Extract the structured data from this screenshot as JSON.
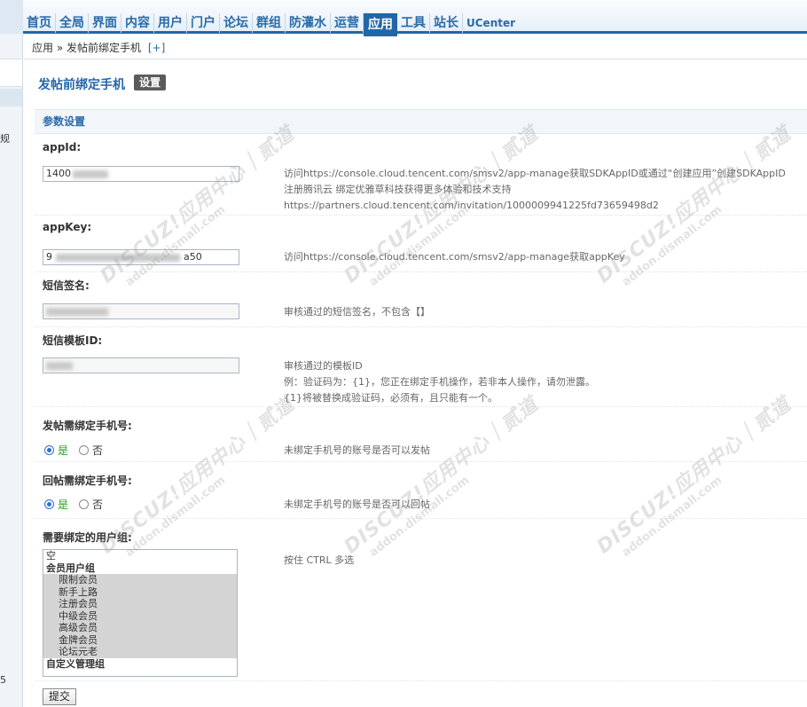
{
  "nav": {
    "items": [
      "首页",
      "全局",
      "界面",
      "内容",
      "用户",
      "门户",
      "论坛",
      "群组",
      "防灌水",
      "运营",
      "应用",
      "工具",
      "站长",
      "UCenter"
    ],
    "active_index": 10
  },
  "sidebar": {
    "chars": [
      "规",
      "5"
    ]
  },
  "breadcrumb": {
    "root": "应用",
    "sep": "»",
    "current": "发帖前绑定手机",
    "add": "[+]"
  },
  "page": {
    "title": "发帖前绑定手机",
    "tab_label": "设置"
  },
  "section": {
    "title": "参数设置"
  },
  "fields": {
    "appid": {
      "label": "appId:",
      "value": "1400",
      "desc": [
        "访问https://console.cloud.tencent.com/smsv2/app-manage获取SDKAppID或通过“创建应用”创建SDKAppID",
        "注册腾讯云 绑定优雅草科技获得更多体验和技术支持",
        "https://partners.cloud.tencent.com/invitation/1000009941225fd73659498d2"
      ]
    },
    "appkey": {
      "label": "appKey:",
      "value_start": "9",
      "value_end": "a50",
      "desc": "访问https://console.cloud.tencent.com/smsv2/app-manage获取appKey"
    },
    "sign": {
      "label": "短信签名:",
      "desc": "审核通过的短信签名，不包含【】"
    },
    "template": {
      "label": "短信模板ID:",
      "desc": [
        "审核通过的模板ID",
        "例：验证码为：{1}，您正在绑定手机操作，若非本人操作，请勿泄露。",
        "{1}将被替换成验证码，必须有，且只能有一个。"
      ]
    },
    "post_bind": {
      "label": "发帖需绑定手机号:",
      "yes": "是",
      "no": "否",
      "selected": "yes",
      "desc": "未绑定手机号的账号是否可以发帖"
    },
    "reply_bind": {
      "label": "回帖需绑定手机号:",
      "yes": "是",
      "no": "否",
      "selected": "yes",
      "desc": "未绑定手机号的账号是否可以回帖"
    },
    "groups": {
      "label": "需要绑定的用户组:",
      "desc": "按住 CTRL 多选",
      "options": [
        "空",
        "会员用户组",
        "限制会员",
        "新手上路",
        "注册会员",
        "中级会员",
        "高级会员",
        "金牌会员",
        "论坛元老",
        "自定义管理组"
      ]
    }
  },
  "submit_label": "提交",
  "watermark": {
    "brand": "DISCUZ!应用中心｜贰道",
    "domain": "addon.dismall.com"
  },
  "colors": {
    "accent": "#2366a8",
    "selected_radio_label": "#2b9a2b"
  }
}
